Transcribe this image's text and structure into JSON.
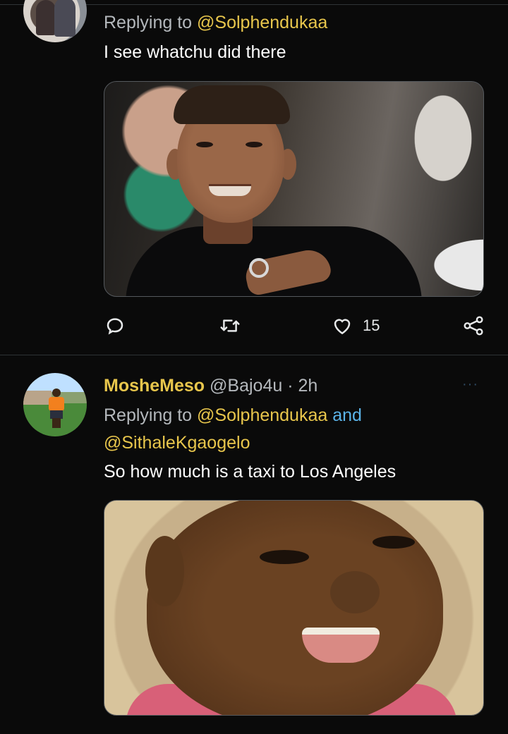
{
  "tweet1": {
    "replying_prefix": "Replying to",
    "replying_handle": "@Solphendukaa",
    "text": "I see whatchu did there",
    "actions": {
      "like_count": "15"
    }
  },
  "tweet2": {
    "display_name": "MosheMeso",
    "handle": "@Bajo4u",
    "separator": "·",
    "time": "2h",
    "more": "···",
    "replying_prefix": "Replying to",
    "replying_handle1": "@Solphendukaa",
    "replying_and": "and",
    "replying_handle2": "@SithaleKgaogelo",
    "text": "So how much is a taxi to Los Angeles"
  },
  "colors": {
    "background": "#0a0a0a",
    "mention": "#e8c64c",
    "link": "#5bb3e8",
    "muted": "#b4b8bc"
  },
  "icons": [
    "reply-icon",
    "retweet-icon",
    "like-icon",
    "share-icon",
    "more-icon"
  ]
}
